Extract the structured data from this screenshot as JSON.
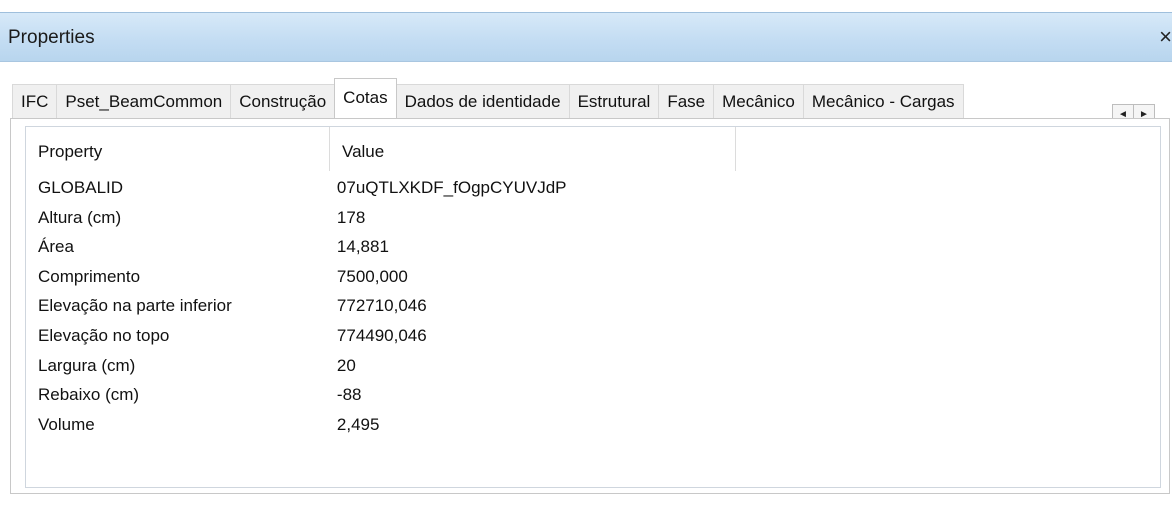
{
  "window": {
    "title": "Properties",
    "close_glyph": "×"
  },
  "tabs": [
    {
      "label": "IFC",
      "active": false
    },
    {
      "label": "Pset_BeamCommon",
      "active": false
    },
    {
      "label": "Construção",
      "active": false
    },
    {
      "label": "Cotas",
      "active": true
    },
    {
      "label": "Dados de identidade",
      "active": false
    },
    {
      "label": "Estrutural",
      "active": false
    },
    {
      "label": "Fase",
      "active": false
    },
    {
      "label": "Mecânico",
      "active": false
    },
    {
      "label": "Mecânico - Cargas",
      "active": false
    }
  ],
  "tab_scroll": {
    "left_icon": "◄",
    "right_icon": "►"
  },
  "grid": {
    "headers": [
      "Property",
      "Value"
    ],
    "rows": [
      {
        "property": "GLOBALID",
        "value": "07uQTLXKDF_fOgpCYUVJdP"
      },
      {
        "property": "Altura (cm)",
        "value": "178"
      },
      {
        "property": "Área",
        "value": "14,881"
      },
      {
        "property": "Comprimento",
        "value": "7500,000"
      },
      {
        "property": "Elevação na parte inferior",
        "value": "772710,046"
      },
      {
        "property": "Elevação no topo",
        "value": "774490,046"
      },
      {
        "property": "Largura (cm)",
        "value": "20"
      },
      {
        "property": "Rebaixo (cm)",
        "value": "-88"
      },
      {
        "property": "Volume",
        "value": "2,495"
      }
    ]
  },
  "colors": {
    "titlebar": "#c4ddf3",
    "tab_inactive": "#f0f0f0",
    "tab_active": "#ffffff",
    "border": "#c8c8c8"
  }
}
